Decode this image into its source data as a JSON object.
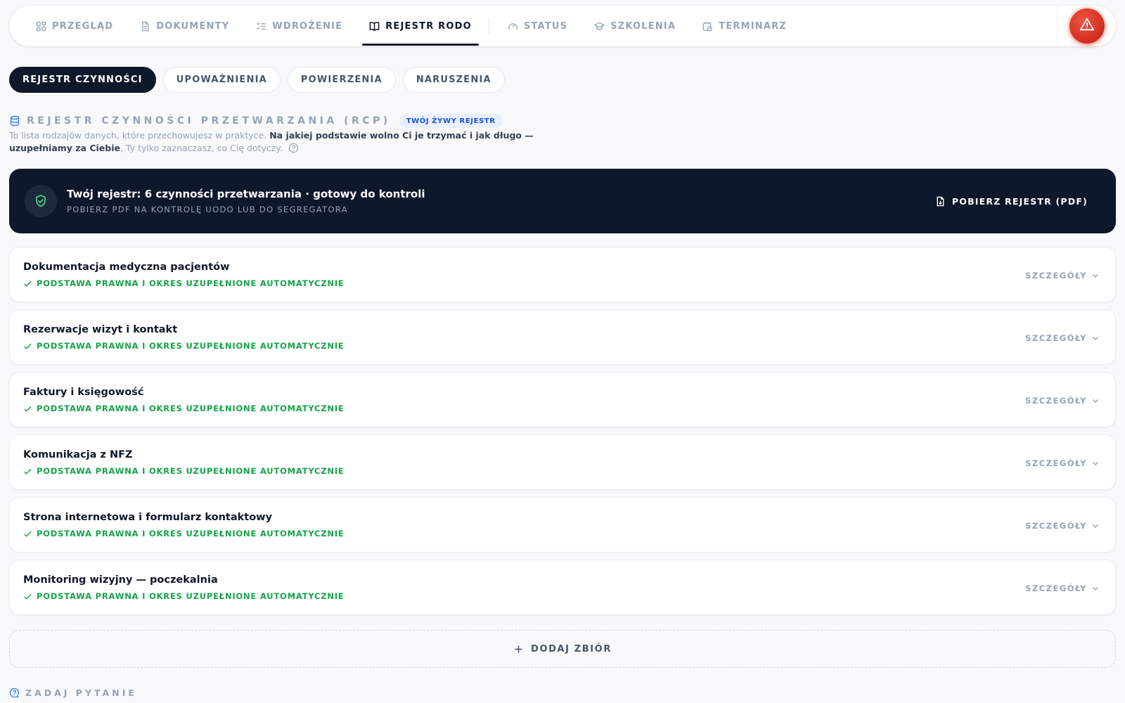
{
  "nav": {
    "items": [
      {
        "label": "PRZEGLĄD",
        "icon": "grid-icon"
      },
      {
        "label": "DOKUMENTY",
        "icon": "document-icon"
      },
      {
        "label": "WDROŻENIE",
        "icon": "checklist-icon"
      },
      {
        "label": "REJESTR RODO",
        "icon": "book-icon"
      },
      {
        "label": "STATUS",
        "icon": "gauge-icon"
      },
      {
        "label": "SZKOLENIA",
        "icon": "graduation-cap-icon"
      },
      {
        "label": "TERMINARZ",
        "icon": "calendar-clock-icon"
      }
    ],
    "active": "REJESTR RODO",
    "alert_icon": "warning-triangle-icon"
  },
  "subtabs": [
    {
      "label": "REJESTR CZYNNOŚCI",
      "active": true
    },
    {
      "label": "UPOWAŻNIENIA",
      "active": false
    },
    {
      "label": "POWIERZENIA",
      "active": false
    },
    {
      "label": "NARUSZENIA",
      "active": false
    }
  ],
  "section": {
    "title": "REJESTR CZYNNOŚCI PRZETWARZANIA (RCP)",
    "badge": "TWÓJ ŻYWY REJESTR",
    "desc_part1": "To lista rodzajów danych, które przechowujesz w praktyce.",
    "desc_bold": "Na jakiej podstawie wolno Ci je trzymać i jak długo — uzupełniamy za Ciebie",
    "desc_part2": ", Ty tylko zaznaczasz, co Cię dotyczy."
  },
  "banner": {
    "title": "Twój rejestr: 6 czynności przetwarzania · gotowy do kontroli",
    "subtitle": "POBIERZ PDF NA KONTROLĘ UODO LUB DO SEGREGATORA",
    "button": "POBIERZ REJESTR (PDF)"
  },
  "activities": [
    {
      "title": "Dokumentacja medyczna pacjentów",
      "status": "PODSTAWA PRAWNA I OKRES UZUPEŁNIONE AUTOMATYCZNIE",
      "details": "SZCZEGÓŁY"
    },
    {
      "title": "Rezerwacje wizyt i kontakt",
      "status": "PODSTAWA PRAWNA I OKRES UZUPEŁNIONE AUTOMATYCZNIE",
      "details": "SZCZEGÓŁY"
    },
    {
      "title": "Faktury i księgowość",
      "status": "PODSTAWA PRAWNA I OKRES UZUPEŁNIONE AUTOMATYCZNIE",
      "details": "SZCZEGÓŁY"
    },
    {
      "title": "Komunikacja z NFZ",
      "status": "PODSTAWA PRAWNA I OKRES UZUPEŁNIONE AUTOMATYCZNIE",
      "details": "SZCZEGÓŁY"
    },
    {
      "title": "Strona internetowa i formularz kontaktowy",
      "status": "PODSTAWA PRAWNA I OKRES UZUPEŁNIONE AUTOMATYCZNIE",
      "details": "SZCZEGÓŁY"
    },
    {
      "title": "Monitoring wizyjny — poczekalnia",
      "status": "PODSTAWA PRAWNA I OKRES UZUPEŁNIONE AUTOMATYCZNIE",
      "details": "SZCZEGÓŁY"
    }
  ],
  "add_set": "DODAJ ZBIÓR",
  "ask": "ZADAJ PYTANIE",
  "colors": {
    "navy": "#0f172a",
    "muted": "#94a3b8",
    "success": "#16a34a",
    "alert": "#d12c1d",
    "badge_bg": "#e8f0fe",
    "badge_text": "#1d4ed8"
  }
}
